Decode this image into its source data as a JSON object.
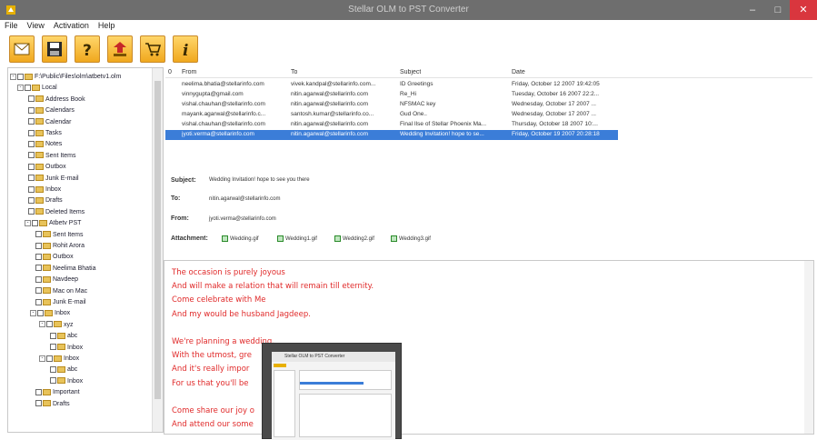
{
  "window": {
    "title": "Stellar OLM to PST Converter",
    "minimize": "–",
    "maximize": "□",
    "close": "✕"
  },
  "menu": [
    "File",
    "View",
    "Activation",
    "Help"
  ],
  "toolbar": [
    {
      "icon": "mail-icon"
    },
    {
      "icon": "save-icon"
    },
    {
      "icon": "help-icon"
    },
    {
      "icon": "download-icon"
    },
    {
      "icon": "cart-icon"
    },
    {
      "icon": "info-icon"
    }
  ],
  "tree": [
    {
      "label": "F:\\Public\\Files\\olm\\atbetv1.olm",
      "chk": true,
      "exp": "-"
    },
    {
      "label": "Local",
      "exp": "-",
      "chk": true,
      "icon": "user"
    },
    {
      "label": "Address Book",
      "chk": true
    },
    {
      "label": "Calendars",
      "chk": true
    },
    {
      "label": "Calendar",
      "chk": true
    },
    {
      "label": "Tasks",
      "chk": true
    },
    {
      "label": "Notes",
      "chk": true
    },
    {
      "label": "Sent Items",
      "chk": true
    },
    {
      "label": "Outbox",
      "chk": true
    },
    {
      "label": "Junk E-mail",
      "chk": true
    },
    {
      "label": "Inbox",
      "chk": true
    },
    {
      "label": "Drafts",
      "chk": true
    },
    {
      "label": "Deleted Items",
      "chk": true
    },
    {
      "label": "Atbetv PST",
      "exp": "-",
      "chk": true
    },
    {
      "label": "Sent Items",
      "chk": true
    },
    {
      "label": "Rohit Arora",
      "chk": true
    },
    {
      "label": "Outbox",
      "chk": true
    },
    {
      "label": "Neelima Bhatia",
      "chk": true
    },
    {
      "label": "Navdeep",
      "chk": true
    },
    {
      "label": "Mac on Mac",
      "chk": true
    },
    {
      "label": "Junk E-mail",
      "chk": true
    },
    {
      "label": "Inbox",
      "exp": "-",
      "chk": true
    },
    {
      "label": "xyz",
      "exp": "-",
      "chk": true
    },
    {
      "label": "abc",
      "chk": true
    },
    {
      "label": "Inbox",
      "chk": true
    },
    {
      "label": "Inbox",
      "exp": "-",
      "chk": true
    },
    {
      "label": "abc",
      "chk": true
    },
    {
      "label": "Inbox",
      "chk": true
    },
    {
      "label": "Important",
      "chk": true
    },
    {
      "label": "Drafts",
      "chk": true
    }
  ],
  "list": {
    "headers": {
      "attach": "0",
      "from": "From",
      "to": "To",
      "subject": "Subject",
      "date": "Date"
    },
    "rows": [
      {
        "from": "neelima.bhatia@stellarinfo.com",
        "to": "vivek.kandpal@stellarinfo.com...",
        "subject": "ID Greetings",
        "date": "Friday, October 12 2007 19:42:05"
      },
      {
        "from": "vinnygupta@gmail.com",
        "to": "nitin.agarwal@stellarinfo.com",
        "subject": "Re_Hi",
        "date": "Tuesday, October 16 2007 22:2..."
      },
      {
        "from": "vishal.chauhan@stellarinfo.com",
        "to": "nitin.agarwal@stellarinfo.com",
        "subject": "NFSMAC key",
        "date": "Wednesday, October 17 2007 ..."
      },
      {
        "from": "mayank.agarwal@stellarinfo.c...",
        "to": "santosh.kumar@stellarinfo.co...",
        "subject": "Gud One..",
        "date": "Wednesday, October 17 2007 ..."
      },
      {
        "from": "vishal.chauhan@stellarinfo.com",
        "to": "nitin.agarwal@stellarinfo.com",
        "subject": "Final Ilse of Stellar Phoenix Ma...",
        "date": "Thursday, October 18 2007 10:..."
      },
      {
        "from": "jyoti.verma@stellarinfo.com",
        "to": "nitin.agarwal@stellarinfo.com",
        "subject": "Wedding Invitation! hope to se...",
        "date": "Friday, October 19 2007 20:28:18",
        "selected": true
      }
    ]
  },
  "preview": {
    "subject_label": "Subject:",
    "subject": "Wedding Invitation! hope to see you there",
    "to_label": "To:",
    "to": "nitin.agarwal@stellarinfo.com",
    "from_label": "From:",
    "from": "jyoti.verma@stellarinfo.com",
    "attachment_label": "Attachment:",
    "attachments": [
      "Wedding.gif",
      "Wedding1.gif",
      "Wedding2.gif",
      "Wedding3.gif"
    ]
  },
  "body_lines": [
    "The occasion is purely joyous",
    "And will make a relation that will remain till eternity.",
    "Come celebrate with Me",
    "And my would be husband Jagdeep.",
    "",
    "We're planning a wedding,",
    "With the utmost, gre",
    "And it's really impor",
    "For us that you'll be",
    "",
    "Come share our joy o",
    "And attend our some"
  ],
  "popup": {
    "title": "Stellar OLM to PST Converter"
  }
}
